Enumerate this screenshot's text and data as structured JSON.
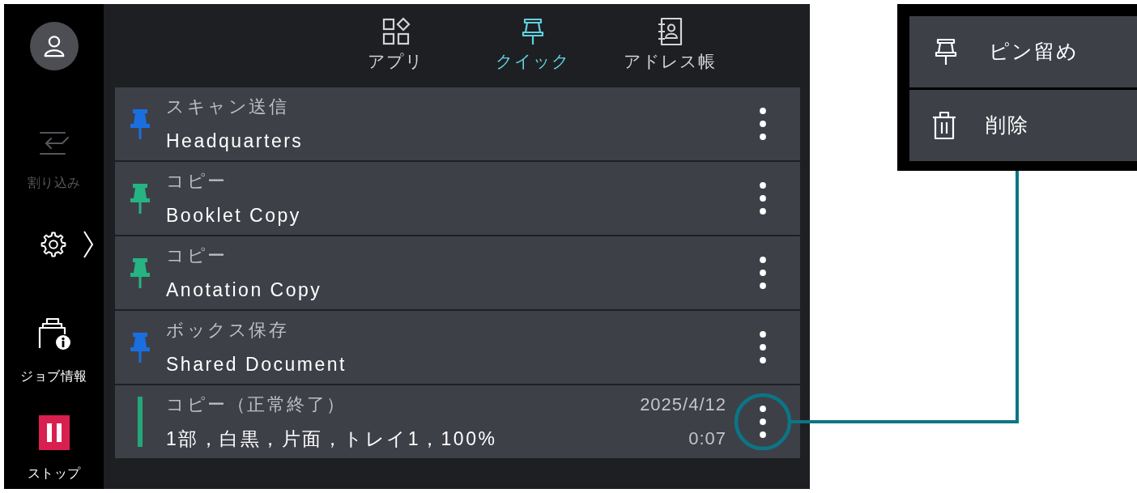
{
  "sidebar": {
    "interrupt": {
      "label": "割り込み",
      "disabled": true
    },
    "job_info": {
      "label": "ジョブ情報"
    },
    "stop": {
      "label": "ストップ"
    }
  },
  "tabs": [
    {
      "label": "アプリ",
      "selected": false
    },
    {
      "label": "クイック",
      "selected": true
    },
    {
      "label": "アドレス帳",
      "selected": false
    }
  ],
  "list": {
    "rows": [
      {
        "kind": "pinned",
        "color": "#1a6fe0",
        "category": "スキャン送信",
        "title": "Headquarters",
        "callout": false
      },
      {
        "kind": "pinned",
        "color": "#26b482",
        "category": "コピー",
        "title": "Booklet Copy",
        "callout": false
      },
      {
        "kind": "pinned",
        "color": "#26b482",
        "category": "コピー",
        "title": "Anotation Copy",
        "callout": false
      },
      {
        "kind": "pinned",
        "color": "#1a6fe0",
        "category": "ボックス保存",
        "title": "Shared Document",
        "callout": false
      },
      {
        "kind": "history",
        "color": "#22a878",
        "category": "コピー（正常終了）",
        "title": "1部，白黒，片面，トレイ1，100%",
        "date": "2025/4/12",
        "time": "0:07",
        "callout": true
      }
    ]
  },
  "context_menu": {
    "items": [
      {
        "label": "ピン留め"
      },
      {
        "label": "削除"
      }
    ]
  }
}
